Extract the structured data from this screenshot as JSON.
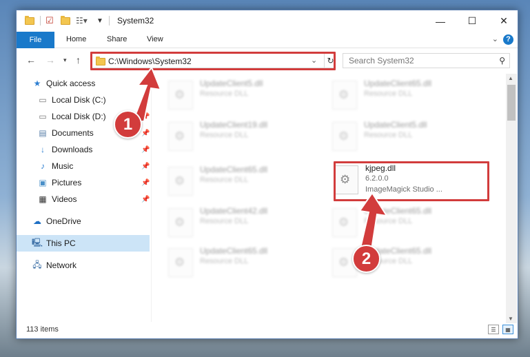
{
  "window": {
    "title": "System32",
    "minimize": "—",
    "maximize": "☐",
    "close": "✕"
  },
  "ribbon": {
    "tabs": [
      "File",
      "Home",
      "Share",
      "View"
    ],
    "help": "?"
  },
  "address": {
    "path": "C:\\Windows\\System32",
    "search_placeholder": "Search System32"
  },
  "sidebar": {
    "items": [
      {
        "label": "Quick access",
        "icon": "star-icon"
      },
      {
        "label": "Local Disk (C:)",
        "icon": "drive-icon",
        "pinned": true
      },
      {
        "label": "Local Disk (D:)",
        "icon": "drive-icon",
        "pinned": true
      },
      {
        "label": "Documents",
        "icon": "documents-icon",
        "pinned": true
      },
      {
        "label": "Downloads",
        "icon": "download-icon",
        "pinned": true
      },
      {
        "label": "Music",
        "icon": "music-icon",
        "pinned": true
      },
      {
        "label": "Pictures",
        "icon": "pictures-icon",
        "pinned": true
      },
      {
        "label": "Videos",
        "icon": "videos-icon",
        "pinned": true
      },
      {
        "label": "OneDrive",
        "icon": "cloud-icon"
      },
      {
        "label": "This PC",
        "icon": "computer-icon",
        "selected": true
      },
      {
        "label": "Network",
        "icon": "network-icon"
      }
    ]
  },
  "files": [
    {
      "name": "UpdateClient5.dll",
      "desc": "Resource DLL"
    },
    {
      "name": "UpdateClient65.dll",
      "desc": "Resource DLL"
    },
    {
      "name": "UpdateClient19.dll",
      "desc": "Resource DLL"
    },
    {
      "name": "UpdateClient5.dll",
      "desc": "Resource DLL"
    },
    {
      "name": "UpdateClient65.dll",
      "desc": "Resource DLL"
    },
    {
      "name": "kjpeg.dll",
      "version": "6.2.0.0",
      "desc": "ImageMagick Studio ..."
    },
    {
      "name": "UpdateClient42.dll",
      "desc": "Resource DLL"
    },
    {
      "name": "UpdateClient65.dll",
      "desc": "Resource DLL"
    },
    {
      "name": "UpdateClient65.dll",
      "desc": "Resource DLL"
    },
    {
      "name": "UpdateClient65.dll",
      "desc": "Resource DLL"
    }
  ],
  "status": {
    "item_count": "113 items"
  },
  "callouts": [
    "1",
    "2"
  ],
  "colors": {
    "accent": "#1979ca",
    "highlight": "#d23c3c",
    "selected_bg": "#cce4f7"
  }
}
